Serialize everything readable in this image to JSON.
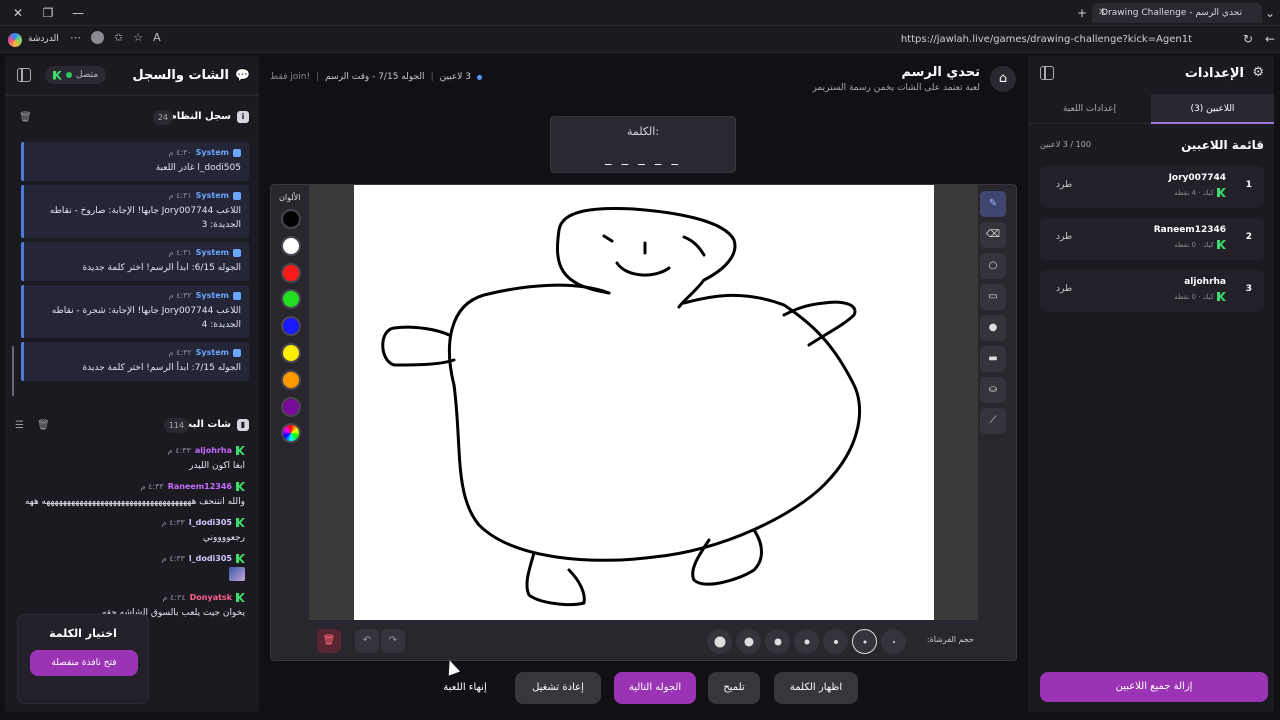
{
  "browser": {
    "tab_title": "تحدي الرسم - Drawing Challenge",
    "url": "https://jawlah.live/games/drawing-challenge?kick=Agen1t",
    "copilot_label": "الدردشة"
  },
  "left_panel": {
    "title": "الشات والسجل",
    "status": "متصل",
    "system_log": {
      "label": "سجل النظام",
      "count": "24",
      "messages": [
        {
          "name": "System",
          "time": "٤:٣٠ م",
          "text": "l_dodi505 غادر اللعبة"
        },
        {
          "name": "System",
          "time": "٤:٣١ م",
          "text": "اللاعب Jory007744 جابها! الإجابة: صاروخ - نقاطه الجديدة: 3"
        },
        {
          "name": "System",
          "time": "٤:٣١ م",
          "text": "الجوله 6/15: ابدأ الرسم! اختر كلمة جديدة"
        },
        {
          "name": "System",
          "time": "٤:٣٢ م",
          "text": "اللاعب Jory007744 جابها! الإجابة: شجرة - نقاطه الجديدة: 4"
        },
        {
          "name": "System",
          "time": "٤:٣٢ م",
          "text": "الجوله 7/15: ابدأ الرسم! اختر كلمة جديدة"
        }
      ]
    },
    "stream_chat": {
      "label": "شات البث",
      "count": "114",
      "messages": [
        {
          "name": "aljohrha",
          "time": "٤:٣٣ م",
          "color": "#c66bff",
          "text": "ابغا اكون الليدر"
        },
        {
          "name": "Raneem12346",
          "time": "٤:٣٣ م",
          "color": "#c66bff",
          "text": "والله انننحف ههههههههههههههههههههههههههههههههههههه ههه"
        },
        {
          "name": "l_dodi305",
          "time": "٤:٣٣ م",
          "color": "#cfc9ff",
          "text": "رجعووووني"
        },
        {
          "name": "l_dodi305",
          "time": "٤:٣٣ م",
          "color": "#cfc9ff",
          "text": ""
        },
        {
          "name": "Donyatsk",
          "time": "٤:٣٤ م",
          "color": "#ff5f8f",
          "text": "يخوان جيت يلعب بالسوق الشاشه حقه"
        }
      ]
    },
    "word_pick": {
      "title": "اختيار الكلمة",
      "button": "فتح نافذة منفصلة"
    }
  },
  "main": {
    "title": "تحدي الرسم",
    "subtitle": "لعبة تعتمد على الشات يخمن رسمة الستريمر",
    "players_count": "3 لاعبين",
    "round_info": "الجوله 7/15 - وقت الرسم",
    "join_hint": "!join فقط",
    "word_label": "الكلمة:",
    "word_dashes": "_ _ _ _ _",
    "colors_label": "الألوان",
    "brush_label": "حجم الفرشاة:",
    "colors": [
      "#000000",
      "#ffffff",
      "#ff1a1a",
      "#22dd22",
      "#1a1aff",
      "#ffee00",
      "#ff9900",
      "#7a0a9a"
    ],
    "actions": {
      "show_word": "اظهار الكلمة",
      "hint": "تلميح",
      "next_round": "الجوله التالية",
      "restart": "إعادة تشغيل",
      "end_game": "إنهاء اللعبة"
    }
  },
  "right_panel": {
    "title": "الإعدادات",
    "tab_players": "اللاعبين (3)",
    "tab_settings": "إعدادات اللعبة",
    "players_title": "قائمة اللاعبين",
    "players_count": "100 / 3 لاعبين",
    "players": [
      {
        "rank": "1",
        "name": "Jory007744",
        "meta": "كيك · 4 نقطة",
        "kick": "طرد"
      },
      {
        "rank": "2",
        "name": "Raneem12346",
        "meta": "كيك · 0 نقطة",
        "kick": "طرد"
      },
      {
        "rank": "3",
        "name": "aljohrha",
        "meta": "كيك · 0 نقطة",
        "kick": "طرد"
      }
    ],
    "remove_all": "إزالة جميع اللاعبين"
  }
}
